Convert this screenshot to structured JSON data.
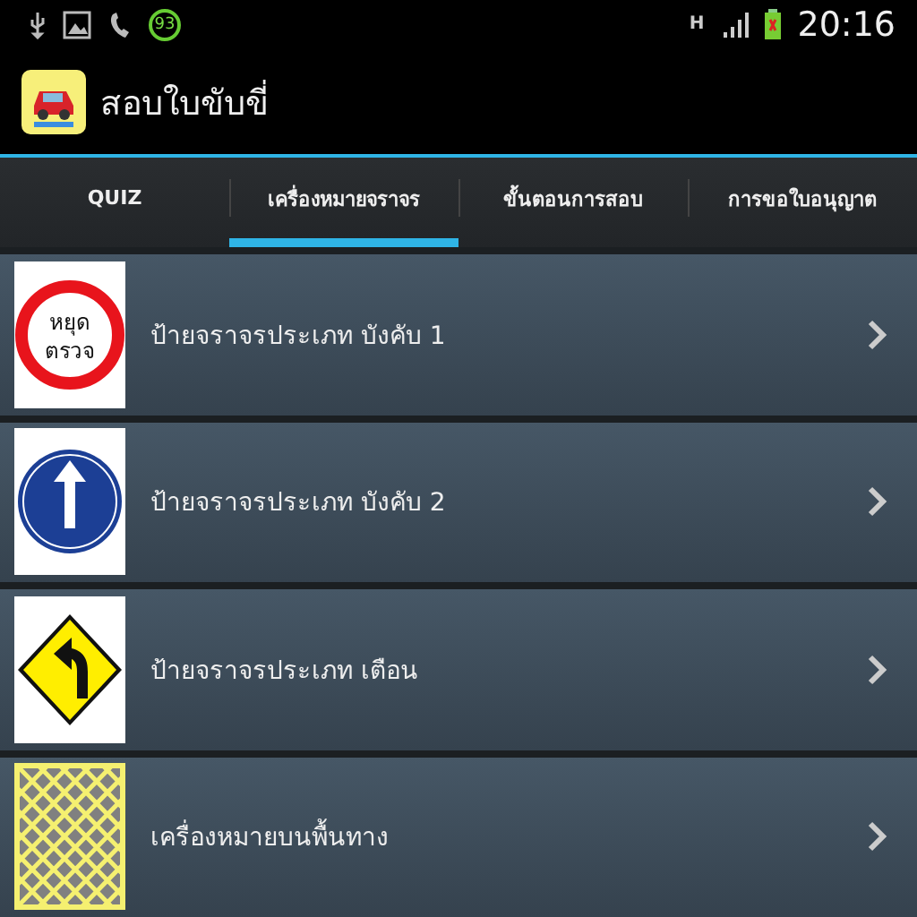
{
  "status_bar": {
    "badge": "93",
    "network": "H",
    "time": "20:16"
  },
  "app_bar": {
    "title": "สอบใบขับขี่"
  },
  "tabs": [
    {
      "label": "QUIZ",
      "selected": false
    },
    {
      "label": "เครื่องหมายจราจร",
      "selected": true
    },
    {
      "label": "ขั้นตอนการสอบ",
      "selected": false
    },
    {
      "label": "การขอใบอนุญาต",
      "selected": false
    }
  ],
  "items": [
    {
      "kind": "stop",
      "sign_text": [
        "หยุด",
        "ตรวจ"
      ],
      "label": "ป้ายจราจรประเภท บังคับ 1"
    },
    {
      "kind": "ahead",
      "label": "ป้ายจราจรประเภท บังคับ 2"
    },
    {
      "kind": "warning",
      "label": "ป้ายจราจรประเภท เตือน"
    },
    {
      "kind": "marking",
      "label": "เครื่องหมายบนพื้นทาง"
    }
  ]
}
